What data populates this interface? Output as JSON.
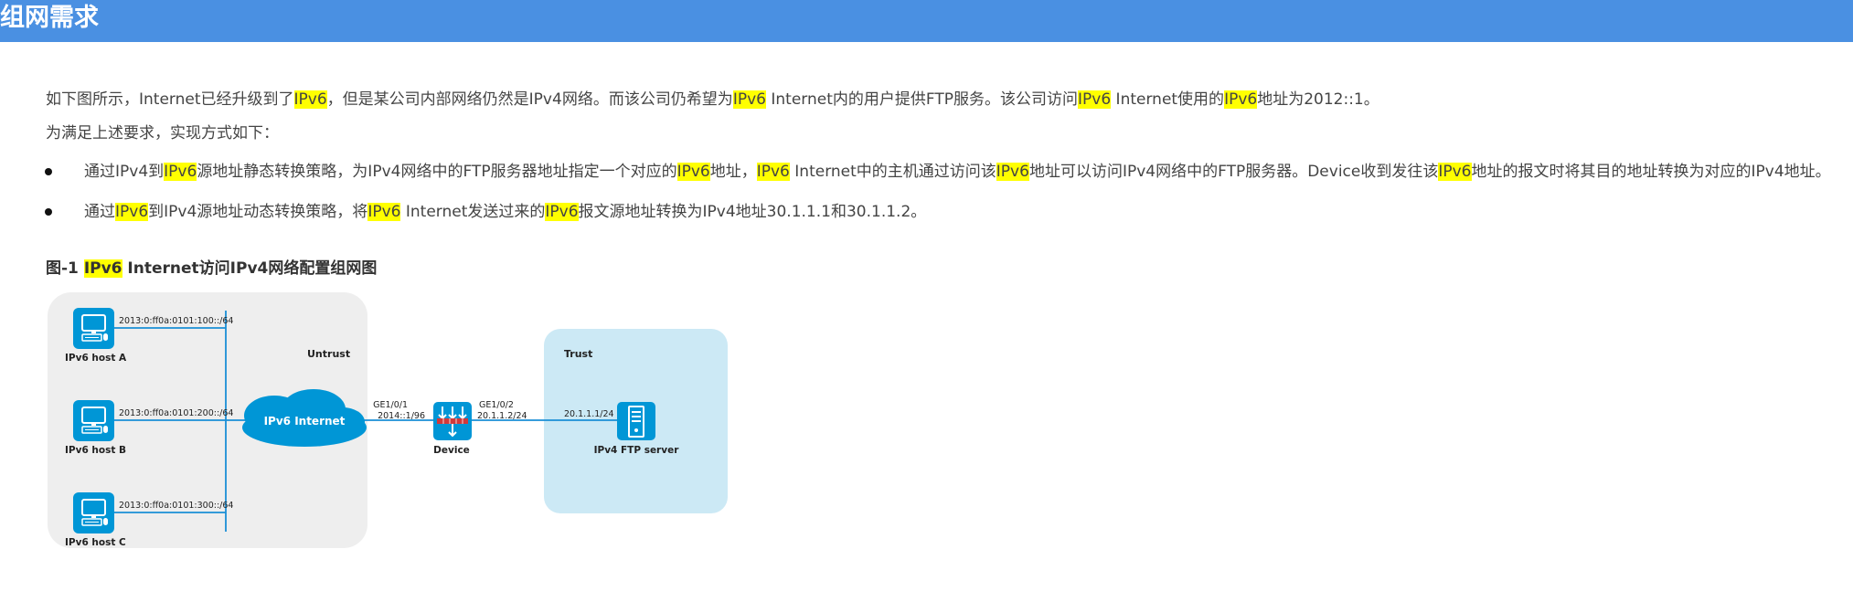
{
  "header": {
    "title": "组网需求"
  },
  "highlight_term": "IPv6",
  "paragraphs": [
    {
      "id": "p1",
      "bullet": false,
      "parts": [
        "如下图所示，Internet已经升级到了",
        "IPv6",
        "，但是某公司内部网络仍然是IPv4网络。而该公司仍希望为",
        "IPv6",
        " Internet内的用户提供FTP服务。该公司访问",
        "IPv6",
        " Internet使用的",
        "IPv6",
        "地址为2012::1。"
      ]
    },
    {
      "id": "p2",
      "bullet": false,
      "parts": [
        "为满足上述要求，实现方式如下："
      ]
    },
    {
      "id": "b1",
      "bullet": true,
      "parts": [
        "通过IPv4到",
        "IPv6",
        "源地址静态转换策略，为IPv4网络中的FTP服务器地址指定一个对应的",
        "IPv6",
        "地址，",
        "IPv6",
        " Internet中的主机通过访问该",
        "IPv6",
        "地址可以访问IPv4网络中的FTP服务器。Device收到发往该",
        "IPv6",
        "地址的报文时将其目的地址转换为对应的IPv4地址。"
      ]
    },
    {
      "id": "b2",
      "bullet": true,
      "parts": [
        "通过",
        "IPv6",
        "到IPv4源地址动态转换策略，将",
        "IPv6",
        " Internet发送过来的",
        "IPv6",
        "报文源地址转换为IPv4地址30.1.1.1和30.1.1.2。"
      ]
    }
  ],
  "figure": {
    "caption_parts": [
      "图-1 ",
      "IPv6",
      " Internet访问IPv4网络配置组网图"
    ],
    "zones": {
      "untrust": "Untrust",
      "trust": "Trust"
    },
    "hosts": [
      {
        "name": "IPv6 host A",
        "prefix": "2013:0:ff0a:0101:100::/64"
      },
      {
        "name": "IPv6 host B",
        "prefix": "2013:0:ff0a:0101:200::/64"
      },
      {
        "name": "IPv6 host C",
        "prefix": "2013:0:ff0a:0101:300::/64"
      }
    ],
    "cloud_label": "IPv6 Internet",
    "device": {
      "name": "Device",
      "if1_name": "GE1/0/1",
      "if1_addr": "2014::1/96",
      "if2_name": "GE1/0/2",
      "if2_addr": "20.1.1.2/24"
    },
    "server": {
      "name": "IPv4 FTP server",
      "addr": "20.1.1.1/24"
    },
    "colors": {
      "link": "#1a8fd6",
      "icon": "#0096d6",
      "untrust_bg": "#eeeeee",
      "trust_bg": "#cce9f5",
      "highlight": "#ffff00"
    }
  }
}
